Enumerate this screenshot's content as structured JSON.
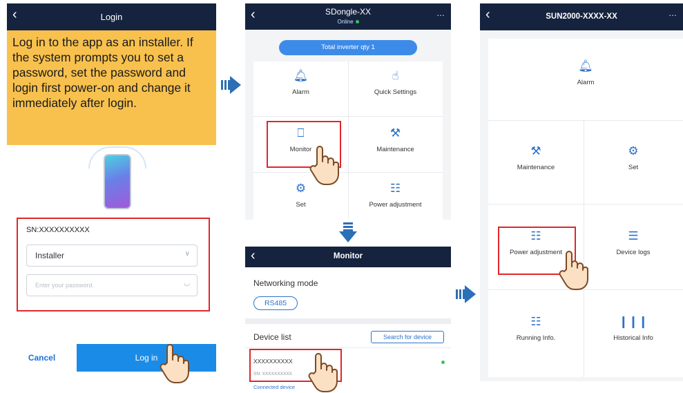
{
  "screen1": {
    "title": "Login",
    "note": "Log in to the app as an installer. If the system prompts you to set a password, set the password and login first power-on and change it immediately after login.",
    "sn": "SN:XXXXXXXXXX",
    "user_select": "Installer",
    "password_placeholder": "Enter your password.",
    "cancel": "Cancel",
    "login": "Log in"
  },
  "screen2": {
    "title": "SDongle-XX",
    "status": "Online",
    "total": "Total inverter qty 1",
    "tiles": [
      "Alarm",
      "Quick Settings",
      "Monitor",
      "Maintenance",
      "Set",
      "Power adjustment"
    ]
  },
  "screen3": {
    "title": "Monitor",
    "networking_label": "Networking mode",
    "networking_value": "RS485",
    "device_list": "Device list",
    "search": "Search for device",
    "device_name": "XXXXXXXXXX",
    "device_sn": "SN: XXXXXXXXXX",
    "device_status": "Connected device"
  },
  "screen4": {
    "title": "SUN2000-XXXX-XX",
    "tiles": [
      "Alarm",
      "Maintenance",
      "Set",
      "Power adjustment",
      "Device logs",
      "Running Info.",
      "Historical Info"
    ]
  },
  "colors": {
    "header": "#15233f",
    "accent": "#2d73c9",
    "note_bg": "#f8c14e",
    "highlight": "#e0262a",
    "online": "#37c35a"
  },
  "icons": [
    "back-icon",
    "more-icon",
    "bell-icon",
    "touch-icon",
    "monitor-icon",
    "wrench-icon",
    "gear-icon",
    "sliders-icon",
    "log-icon",
    "bar-chart-icon",
    "hand-cursor-icon",
    "arrow-right-icon",
    "arrow-down-icon"
  ]
}
